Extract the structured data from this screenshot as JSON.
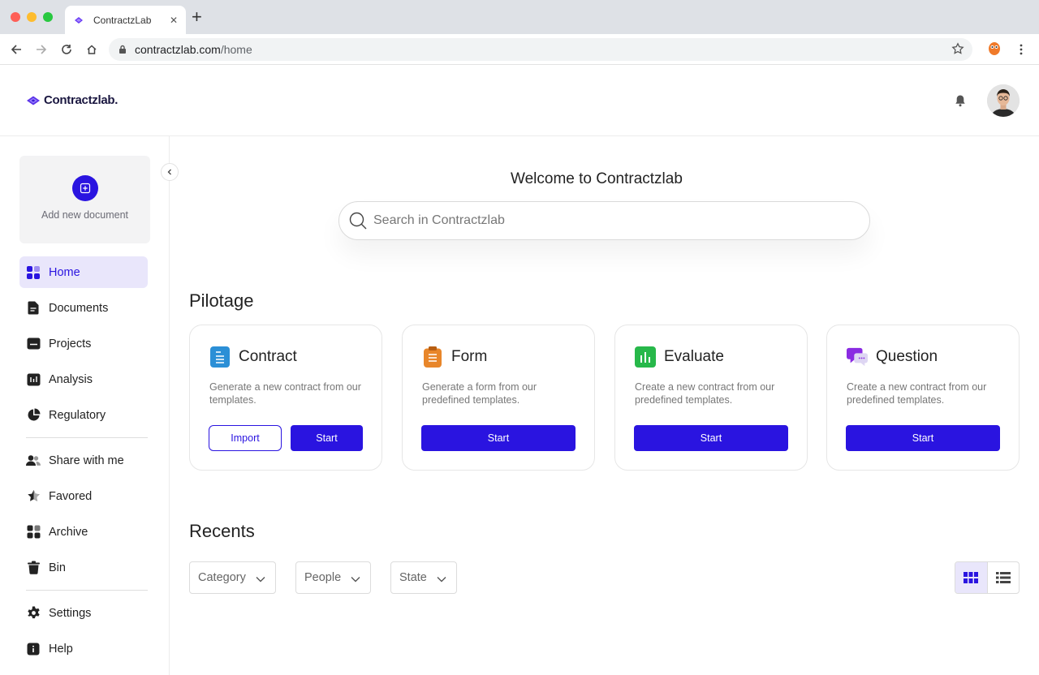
{
  "browser": {
    "tab_title": "ContractzLab",
    "url_host": "contractzlab.com",
    "url_path": "/home"
  },
  "header": {
    "logo_text": "Contractzlab."
  },
  "sidebar": {
    "add_document_label": "Add new document",
    "items": [
      {
        "label": "Home",
        "icon": "grid-icon"
      },
      {
        "label": "Documents",
        "icon": "document-icon"
      },
      {
        "label": "Projects",
        "icon": "folder-icon"
      },
      {
        "label": "Analysis",
        "icon": "chart-icon"
      },
      {
        "label": "Regulatory",
        "icon": "pie-icon"
      },
      {
        "label": "Share with me",
        "icon": "users-icon"
      },
      {
        "label": "Favored",
        "icon": "star-icon"
      },
      {
        "label": "Archive",
        "icon": "archive-icon"
      },
      {
        "label": "Bin",
        "icon": "trash-icon"
      },
      {
        "label": "Settings",
        "icon": "gear-icon"
      },
      {
        "label": "Help",
        "icon": "info-icon"
      }
    ]
  },
  "main": {
    "welcome": "Welcome to Contractzlab",
    "search_placeholder": "Search in Contractzlab",
    "pilotage_title": "Pilotage",
    "cards": [
      {
        "title": "Contract",
        "desc": "Generate a new contract from our templates.",
        "import_label": "Import",
        "start_label": "Start",
        "color": "#2b8fd6"
      },
      {
        "title": "Form",
        "desc": "Generate a form from our predefined templates.",
        "start_label": "Start",
        "color": "#e8862a"
      },
      {
        "title": "Evaluate",
        "desc": "Create a new contract from our predefined templates.",
        "start_label": "Start",
        "color": "#27b84a"
      },
      {
        "title": "Question",
        "desc": "Create a new contract from our predefined templates.",
        "start_label": "Start",
        "color": "#8a2be2"
      }
    ],
    "recents_title": "Recents",
    "filters": [
      "Category",
      "People",
      "State"
    ]
  },
  "colors": {
    "accent": "#2a14e0",
    "active_bg": "#e9e6fb"
  }
}
